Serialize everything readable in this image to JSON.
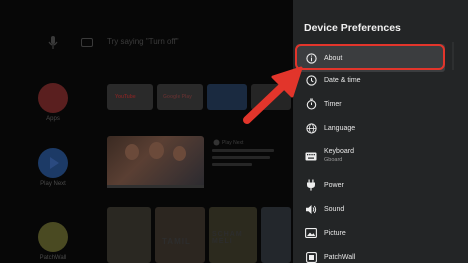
{
  "home": {
    "search_hint": "Try saying \"Turn off\"",
    "apps": [
      {
        "label": "Apps",
        "color": "#5a1f1f"
      },
      {
        "label": "Play Next",
        "color": "#1c3a66"
      },
      {
        "label": "PatchWall",
        "color": "#4a4a22"
      }
    ],
    "tiles": [
      {
        "label": "YouTube",
        "color": "#2a2a2a"
      },
      {
        "label": "Google Play",
        "color": "#2a2a2a"
      },
      {
        "label": "",
        "color": "#1a2a40"
      },
      {
        "label": "",
        "color": "#252525"
      }
    ],
    "play_next_label": "Play Next",
    "posters": [
      {
        "title": "",
        "color": "#2a2822"
      },
      {
        "title": "TAMIL",
        "color": "#2c2620"
      },
      {
        "title": "SCHAM MELI",
        "color": "#2c2a1e"
      },
      {
        "title": "",
        "color": "#23272c"
      }
    ]
  },
  "panel": {
    "title": "Device Preferences",
    "items": [
      {
        "label": "About",
        "sublabel": "",
        "icon": "info-icon"
      },
      {
        "label": "Date & time",
        "sublabel": "",
        "icon": "clock-icon"
      },
      {
        "label": "Timer",
        "sublabel": "",
        "icon": "timer-icon"
      },
      {
        "label": "Language",
        "sublabel": "",
        "icon": "globe-icon"
      },
      {
        "label": "Keyboard",
        "sublabel": "Gboard",
        "icon": "keyboard-icon"
      },
      {
        "label": "Power",
        "sublabel": "",
        "icon": "power-plug-icon"
      },
      {
        "label": "Sound",
        "sublabel": "",
        "icon": "speaker-icon"
      },
      {
        "label": "Picture",
        "sublabel": "",
        "icon": "picture-icon"
      },
      {
        "label": "PatchWall",
        "sublabel": "",
        "icon": "patchwall-icon"
      }
    ]
  },
  "annotation": {
    "highlight_color": "#e2352b",
    "arrow_color": "#e2352b"
  }
}
